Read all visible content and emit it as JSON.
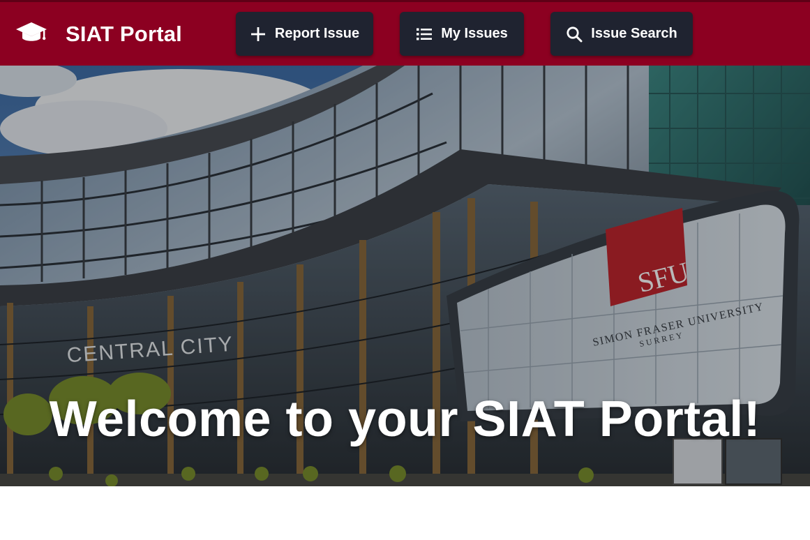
{
  "header": {
    "title": "SIAT Portal",
    "logo_icon": "graduation-cap-icon",
    "background_color": "#8c0021"
  },
  "nav": {
    "buttons": [
      {
        "label": "Report Issue",
        "icon": "plus-icon"
      },
      {
        "label": "My Issues",
        "icon": "list-icon"
      },
      {
        "label": "Issue Search",
        "icon": "search-icon"
      }
    ],
    "button_color": "#1f2330"
  },
  "hero": {
    "title": "Welcome to your SIAT Portal!",
    "image_signs": {
      "mall": "CENTRAL CITY",
      "logo": "SFU",
      "university_line1": "SIMON FRASER UNIVERSITY",
      "university_line2": "SURREY"
    }
  }
}
